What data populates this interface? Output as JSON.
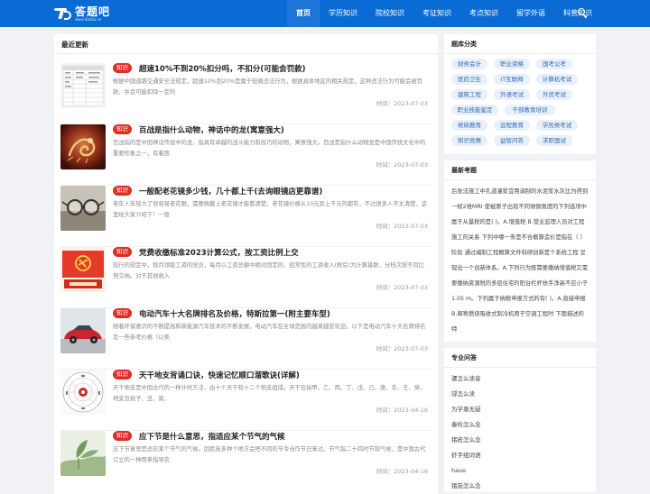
{
  "header": {
    "logo_text": "答题吧",
    "logo_sub": "www.datiba.cn",
    "nav": [
      "首页",
      "学历知识",
      "院校知识",
      "考证知识",
      "考点知识",
      "留学外语",
      "科普知识"
    ],
    "active_index": 0
  },
  "main": {
    "title": "最近更新",
    "articles": [
      {
        "tag": "知识",
        "title": "超速10%不到20%扣分吗，不扣分(可能会罚款)",
        "desc": "根据中国道路交通安全法规定，超速10%到20%是属于轻微违法行为，根据具体地区的相关规定，这种违法行为可能会被罚款，并且可能扣除一定的",
        "time": "时间：2023-07-03"
      },
      {
        "tag": "知识",
        "title": "百战是指什么动物，神话中的龙(寓意强大)",
        "desc": "百战指的是中国神话传说中的龙，指具有卓越的战斗能力和技巧的动物，寓意强大。百战是指什么动物龙是中国传统文化中的重要形象之一，有着悠",
        "time": "时间：2023-07-03"
      },
      {
        "tag": "知识",
        "title": "一般配老花镜多少钱，几十都上千(去询眼镜店更靠谱)",
        "desc": "老年人年轻大了很容易老花眼，需要佩戴上老花镜才能看清楚，老花镜价格从10元到上千元的都有，不过很多人不太清楚，这里给大家介绍下！一般",
        "time": "时间：2023-07-03"
      },
      {
        "tag": "知识",
        "title": "党费收缴标准2023计算公式，按工资比例上交",
        "desc": "现行的规定中，按月领取工资的党员，每月以工资总额中相对固定的、经常性的工资收入(税后)为计算基数，分档次按不同比例交纳。对于其他收入",
        "time": "时间：2023-07-03"
      },
      {
        "tag": "知识",
        "title": "电动汽车十大名牌排名及价格，特斯拉第一(附主要车型)",
        "desc": "随着环保意识的不断提高和新能源汽车技术的不断发展，电动汽车在全球范围内越来越受欢迎。以下是电动汽车十大名牌排名及一些参考价格（以美",
        "time": "时间：2023-07-03"
      },
      {
        "tag": "知识",
        "title": "天干地支背诵口诀，快速记忆顺口溜歌诀(详解)",
        "desc": "天干地支是中国古代的一种计时方法，由十个天干和十二个地支组成。天干包括甲、乙、丙、丁、戊、己、庚、辛、壬、癸，地支包括子、丑、寅、",
        "time": "时间：2023-04-16"
      },
      {
        "tag": "知识",
        "title": "应下节是什么意思，指适应某个节气的气候",
        "desc": "应下节意思是适应某个节气的气候。因民族多种个地方会把不同的节令当作节日来过。节气指二十四时节和气候，是中国古代订立的一种用来指导农",
        "time": "时间：2023-04-16"
      }
    ]
  },
  "sidebar": {
    "categories_title": "题库分类",
    "categories": [
      "财务会计",
      "职业资格",
      "国考公考",
      "医药卫生",
      "IT互联网",
      "计算机考试",
      "建筑工程",
      "外语考试",
      "外贸考试",
      "职业技能鉴定",
      "干部教育培训",
      "继续教育",
      "远程教育",
      "学历类考试",
      "知识竞赛",
      "益智问答",
      "求职面试"
    ],
    "hot_title": "最新考题",
    "hot_text": "后张法施工中孔道灌浆宜用调制的水泥浆水灰比为得到一帧2维MRI 使被原子出现不同倾倒角度的下列选项中 属于从量税的是(  )。A.增值税 B.营业监理人员对工程施工的关系 下列中哪一条是不合概算造价是指在（ ）阶段 通过编制工程概算文件科研创新是个系统工程 呈现出一个创新体系。A.下列行为既需要缴纳增值税又需要缴纳资源税的多层住宅的阳台栏杆扶手净高不应小于1.05 m。下列属于纳税申报方式的有(  )。A.直接申报 B.邮寄燃烧吸收式制冷机用于空调工程时 下面描述的特",
    "qa_title": "专业问答",
    "qa": [
      "骡怎么读音",
      "郜怎么读",
      "为学患无疑",
      "秦检怎么念",
      "猪疮怎么念",
      "虾字组词语",
      "have",
      "猪茹怎么念"
    ]
  }
}
